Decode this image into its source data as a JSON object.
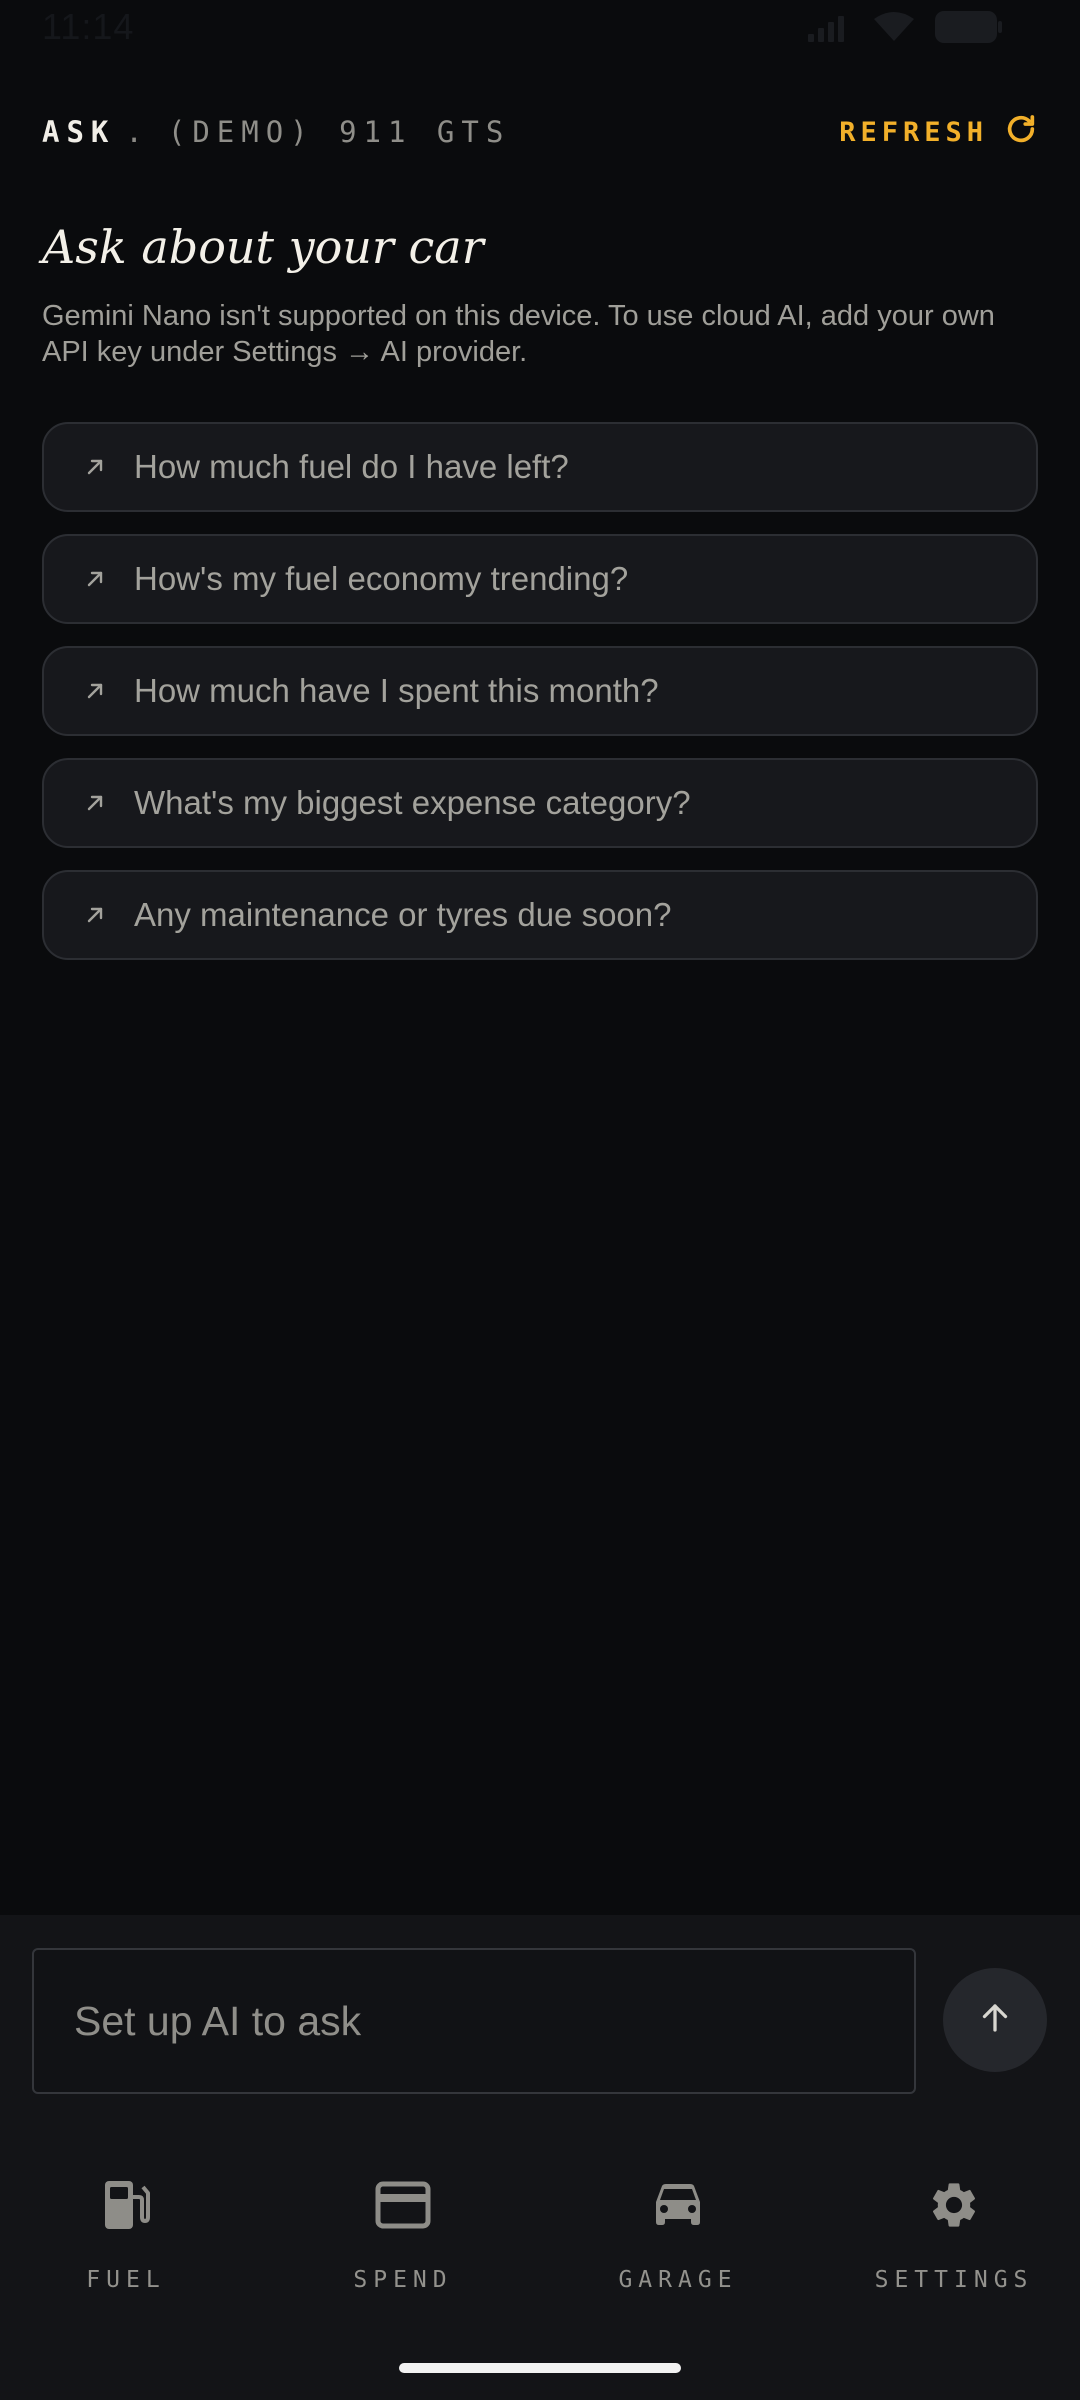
{
  "status_bar": {
    "time": "11:14"
  },
  "header": {
    "section": "ASK",
    "separator": ".",
    "vehicle": "(DEMO) 911 GTS",
    "refresh_label": "REFRESH"
  },
  "intro": {
    "title": "Ask about your car",
    "subtitle": "Gemini Nano isn't supported on this device. To use cloud AI, add your own API key under Settings → AI provider."
  },
  "suggestions": [
    {
      "label": "How much fuel do I have left?",
      "icon": "arrow-up-right-icon"
    },
    {
      "label": "How's my fuel economy trending?",
      "icon": "arrow-up-right-icon"
    },
    {
      "label": "How much have I spent this month?",
      "icon": "arrow-up-right-icon"
    },
    {
      "label": "What's my biggest expense category?",
      "icon": "arrow-up-right-icon"
    },
    {
      "label": "Any maintenance or tyres due soon?",
      "icon": "arrow-up-right-icon"
    }
  ],
  "composer": {
    "placeholder": "Set up AI to ask",
    "send_icon": "arrow-up-icon"
  },
  "nav": {
    "items": [
      {
        "label": "FUEL",
        "icon": "fuel-pump-icon"
      },
      {
        "label": "SPEND",
        "icon": "credit-card-icon"
      },
      {
        "label": "GARAGE",
        "icon": "car-icon"
      },
      {
        "label": "SETTINGS",
        "icon": "gear-icon"
      }
    ]
  },
  "colors": {
    "background": "#0a0b0d",
    "accent": "#f2b02a",
    "card": "#17181c",
    "muted_text": "#a3a29c"
  }
}
